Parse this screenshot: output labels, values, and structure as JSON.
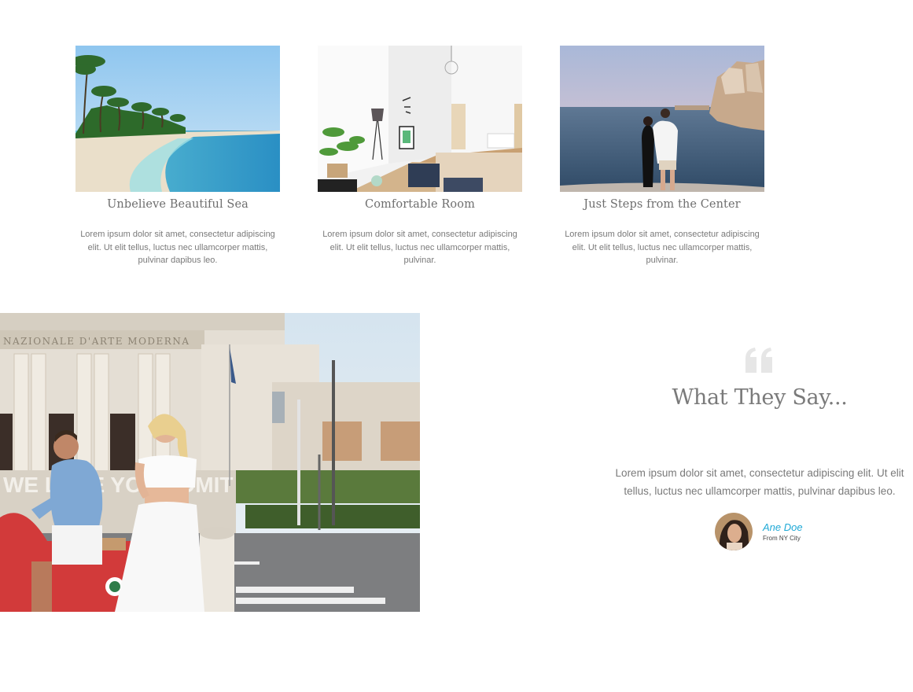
{
  "cards": [
    {
      "title": "Unbelieve Beautiful Sea",
      "text": "Lorem ipsum dolor sit amet, consectetur adipiscing elit. Ut elit tellus, luctus nec ullamcorper mattis, pulvinar dapibus leo."
    },
    {
      "title": "Comfortable Room",
      "text": "Lorem ipsum dolor sit amet, consectetur adipiscing elit. Ut elit tellus, luctus nec ullamcorper mattis, pulvinar."
    },
    {
      "title": "Just Steps from the Center",
      "text": "Lorem ipsum dolor sit amet, consectetur adipiscing elit. Ut elit tellus, luctus nec ullamcorper mattis, pulvinar."
    }
  ],
  "testimonial": {
    "icon": "quote-icon",
    "heading": "What They Say...",
    "text": "Lorem ipsum dolor sit amet, consectetur adipiscing elit. Ut elit tellus, luctus nec ullamcorper mattis, pulvinar dapibus leo.",
    "author_name": "Ane Doe",
    "author_location": "From NY City"
  },
  "hero_photo": {
    "building_inscription": "NAZIONALE D'ARTE MODERNA",
    "graffiti": "WE LOVE YOU ADMIT"
  },
  "colors": {
    "accent": "#1fa9d6",
    "text": "#7a7a7a",
    "quote_icon": "#e6e6e6"
  }
}
